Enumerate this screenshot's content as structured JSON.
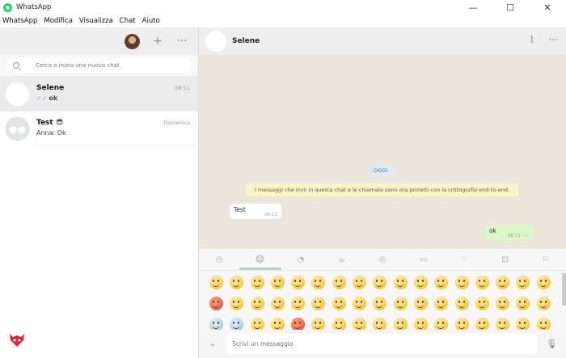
{
  "window": {
    "title": "WhatsApp",
    "minimize": "—",
    "maximize": "☐",
    "close": "✕"
  },
  "menu": [
    "WhatsApp",
    "Modifica",
    "Visualizza",
    "Chat",
    "Aiuto"
  ],
  "left": {
    "search_placeholder": "Cerca o inizia una nuova chat",
    "chats": [
      {
        "name": "Selene",
        "time": "08:11",
        "last": "ok",
        "ticks": "✓✓",
        "active": true
      },
      {
        "name": "Test 😎",
        "time": "Domenica",
        "last": "Anna: Ok"
      }
    ]
  },
  "right": {
    "contact": "Selene",
    "date": "OGGI",
    "encryption": "I messaggi che invii in questa chat e le chiamate sono ora protetti con la crittografia end-to-end.",
    "msg_in": {
      "text": "Test",
      "time": "08:11"
    },
    "msg_out": {
      "text": "ok",
      "time": "08:11",
      "ticks": "✓✓"
    },
    "composer_placeholder": "Scrivi un messaggio"
  },
  "emoji_tabs": [
    "clock-icon",
    "smiley-icon",
    "animal-icon",
    "food-icon",
    "sport-icon",
    "car-icon",
    "bulb-icon",
    "symbol-icon",
    "flag-icon"
  ],
  "colors": {
    "accent": "#25d366",
    "outgoing": "#dcf8c6",
    "notice": "#fcf4c4",
    "date_pill": "#dcecf7"
  }
}
